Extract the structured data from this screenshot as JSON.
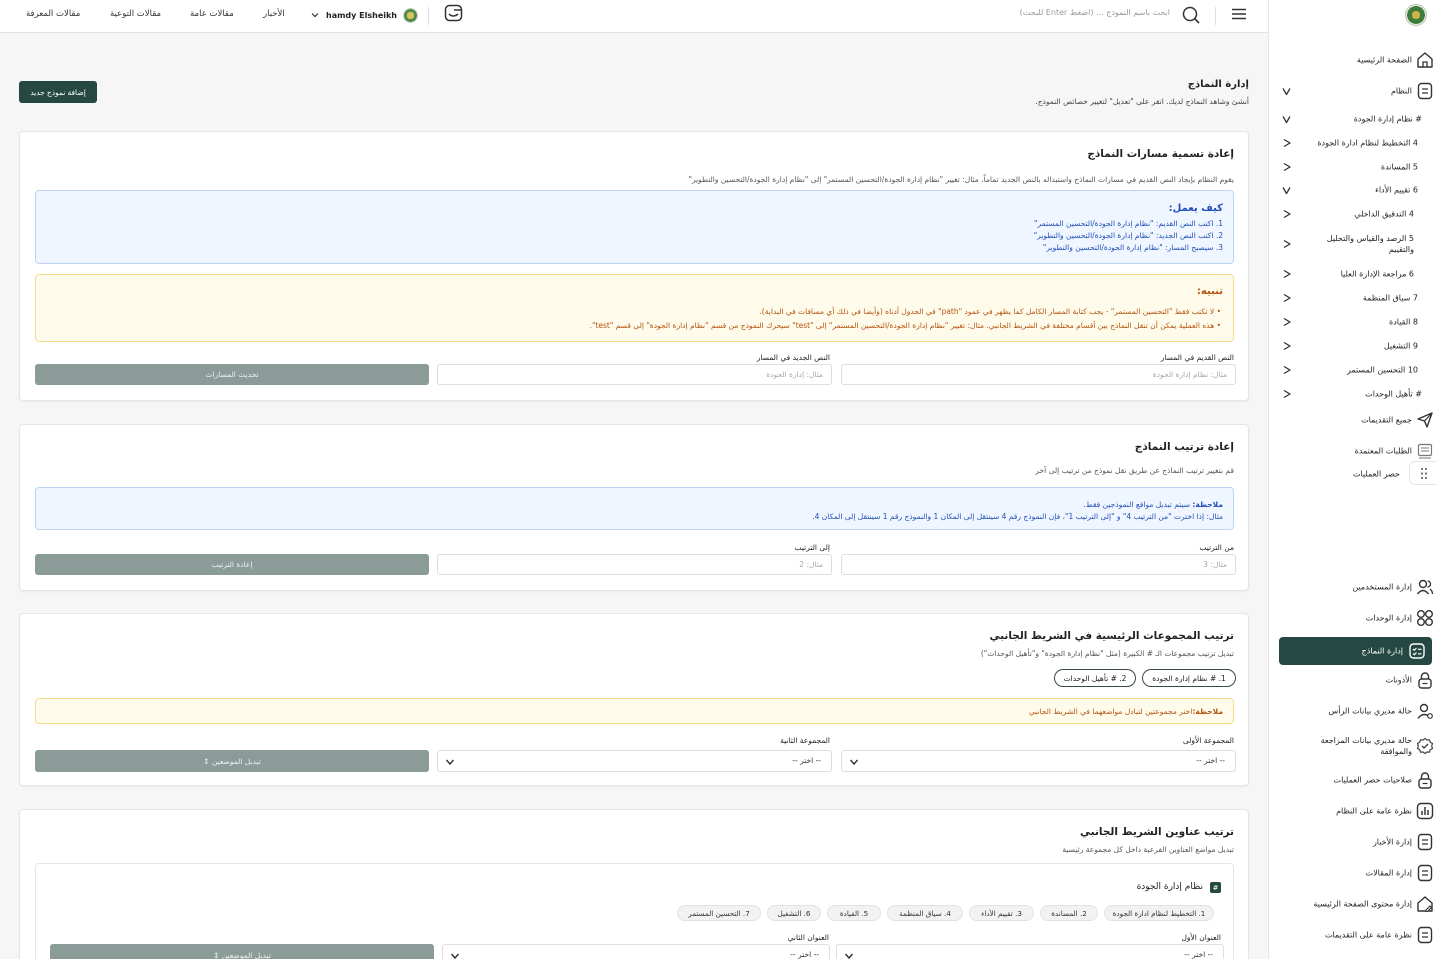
{
  "topbar": {
    "links": [
      "مقالات المعرفة",
      "مقالات التوعية",
      "مقالات عامة",
      "الأخبار"
    ],
    "user_name": "hamdy Elsheikh",
    "search_placeholder": "ابحث باسم النموذج ... (اضغط Enter للبحث)"
  },
  "sidebar": {
    "items": [
      {
        "label": "الصفحة الرئيسية",
        "icon": "home-icon"
      },
      {
        "label": "النظام",
        "icon": "document-icon"
      },
      {
        "label": "# نظام إدارة الجودة"
      },
      {
        "label": "4 التخطيط لنظام ادارة الجودة"
      },
      {
        "label": "5 المساندة"
      },
      {
        "label": "6 تقييم الأداء"
      },
      {
        "label": "4 التدقيق الداخلي"
      },
      {
        "label": "5 الرصد والقياس والتحليل والتقييم"
      },
      {
        "label": "6 مراجعة الإدارة العليا"
      },
      {
        "label": "7 سياق المنظمة"
      },
      {
        "label": "8 القيادة"
      },
      {
        "label": "9 التشغيل"
      },
      {
        "label": "10 التحسين المستمر"
      },
      {
        "label": "# تأهيل الوحدات"
      },
      {
        "label": "جميع التقديمات",
        "icon": "send-icon"
      },
      {
        "label": "الطلبات المعتمدة",
        "icon": "approved-requests-icon"
      },
      {
        "label": "حصر العمليات",
        "icon": "operations-icon"
      },
      {
        "label": "إدارة المستخدمين",
        "icon": "users-icon"
      },
      {
        "label": "إدارة الوحدات",
        "icon": "grid-icon"
      },
      {
        "label": "إدارة النماذج",
        "icon": "forms-icon"
      },
      {
        "label": "الأذونات",
        "icon": "lock-icon"
      },
      {
        "label": "حالة مديري بيانات الرأس",
        "icon": "user-status-icon"
      },
      {
        "label": "حالة مديري بيانات المراجعة والموافقة",
        "icon": "check-badge-icon"
      },
      {
        "label": "صلاحيات حصر العمليات",
        "icon": "lock-icon"
      },
      {
        "label": "نظرة عامة على النظام",
        "icon": "chart-icon"
      },
      {
        "label": "إدارة الأخبار",
        "icon": "document-icon"
      },
      {
        "label": "إدارة المقالات",
        "icon": "document-icon"
      },
      {
        "label": "إدارة محتوى الصفحة الرئيسية",
        "icon": "home-edit-icon"
      },
      {
        "label": "نظرة عامة على التقديمات",
        "icon": "document-icon"
      }
    ]
  },
  "main": {
    "title": "إدارة النماذج",
    "subtitle": "أنشئ وشاهد النماذج لديك. انقر على \"تعديل\" لتغيير خصائص النموذج.",
    "add_button": "إضافة نموذج جديد"
  },
  "rename": {
    "title": "إعادة تسمية مسارات النماذج",
    "desc": "يقوم النظام بإيجاد النص القديم في مسارات النماذج واستبداله بالنص الجديد تماماً. مثال: تغيير \"نظام إدارة الجودة/التحسين المستمر\" إلى \"نظام إدارة الجودة/التحسين والتطوير\"",
    "how_title": "كيف يعمل:",
    "how_steps": [
      "1. اكتب النص القديم: \"نظام إدارة الجودة/التحسين المستمر\"",
      "2. اكتب النص الجديد: \"نظام إدارة الجودة/التحسين والتطوير\"",
      "3. سيصبح المسار: \"نظام إدارة الجودة/التحسين والتطوير\""
    ],
    "warn_title": "تنبيه:",
    "warn_items": [
      "لا تكتب فقط \"التحسين المستمر\" - يجب كتابة المسار الكامل كما يظهر في عمود \"path\" في الجدول أدناه (وأيضا في ذلك أي مسافات في البداية).",
      "هذه العملية يمكن أن تنقل النماذج بين أقسام مختلفة في الشريط الجانبي. مثال: تغيير \"نظام إدارة الجودة/التحسين المستمر\" إلى \"test\" سيحرك النموذج من قسم \"نظام إدارة الجودة\" إلى قسم \"test\"."
    ],
    "old_label": "النص القديم في المسار",
    "old_placeholder": "مثال: نظام إدارة الجودة",
    "new_label": "النص الجديد في المسار",
    "new_placeholder": "مثال: إدارة الجودة",
    "button": "تحديث المسارات"
  },
  "reorder": {
    "title": "إعادة ترتيب النماذج",
    "desc": "قم بتغيير ترتيب النماذج عن طريق نقل نموذج من ترتيب إلى آخر",
    "note_label": "ملاحظة:",
    "note_text": "سيتم تبديل مواقع النموذجين فقط.",
    "note_example": "مثال: إذا اخترت \"من الترتيب 4\" و \"إلى الترتيب 1\"، فإن النموذج رقم 4 سينتقل إلى المكان 1 والنموذج رقم 1 سينتقل إلى المكان 4.",
    "from_label": "من الترتيب",
    "from_placeholder": "مثال: 3",
    "to_label": "إلى الترتيب",
    "to_placeholder": "مثال: 2",
    "button": "إعادة الترتيب"
  },
  "groups": {
    "title": "ترتيب المجموعات الرئيسية في الشريط الجانبي",
    "desc": "تبديل ترتيب مجموعات الـ # الكبيرة (مثل \"نظام إدارة الجودة\" و\"تأهيل الوحدات\")",
    "pills": [
      "1. # نظام إدارة الجودة",
      "2. # تأهيل الوحدات"
    ],
    "note_label": "ملاحظة:",
    "note_text": "اختر مجموعتين لتبادل مواضعهما في الشريط الجانبي",
    "first_label": "المجموعة الأولى",
    "second_label": "المجموعة الثانية",
    "select_value": "-- اختر --",
    "button": "↕ تبديل الموضعين"
  },
  "headings": {
    "title": "ترتيب عناوين الشريط الجانبي",
    "desc": "تبديل مواضع العناوين الفرعية داخل كل مجموعة رئيسية",
    "group_badge": "#",
    "group_name": "نظام إدارة الجودة",
    "chips": [
      "1. التخطيط لنظام ادارة الجودة",
      "2. المساندة",
      "3. تقييم الأداء",
      "4. سياق المنظمة",
      "5. القيادة",
      "6. التشغيل",
      "7. التحسين المستمر"
    ],
    "first_label": "العنوان الأول",
    "second_label": "العنوان الثاني",
    "select_value": "-- اختر --",
    "button": "↕ تبديل الموضعين"
  }
}
